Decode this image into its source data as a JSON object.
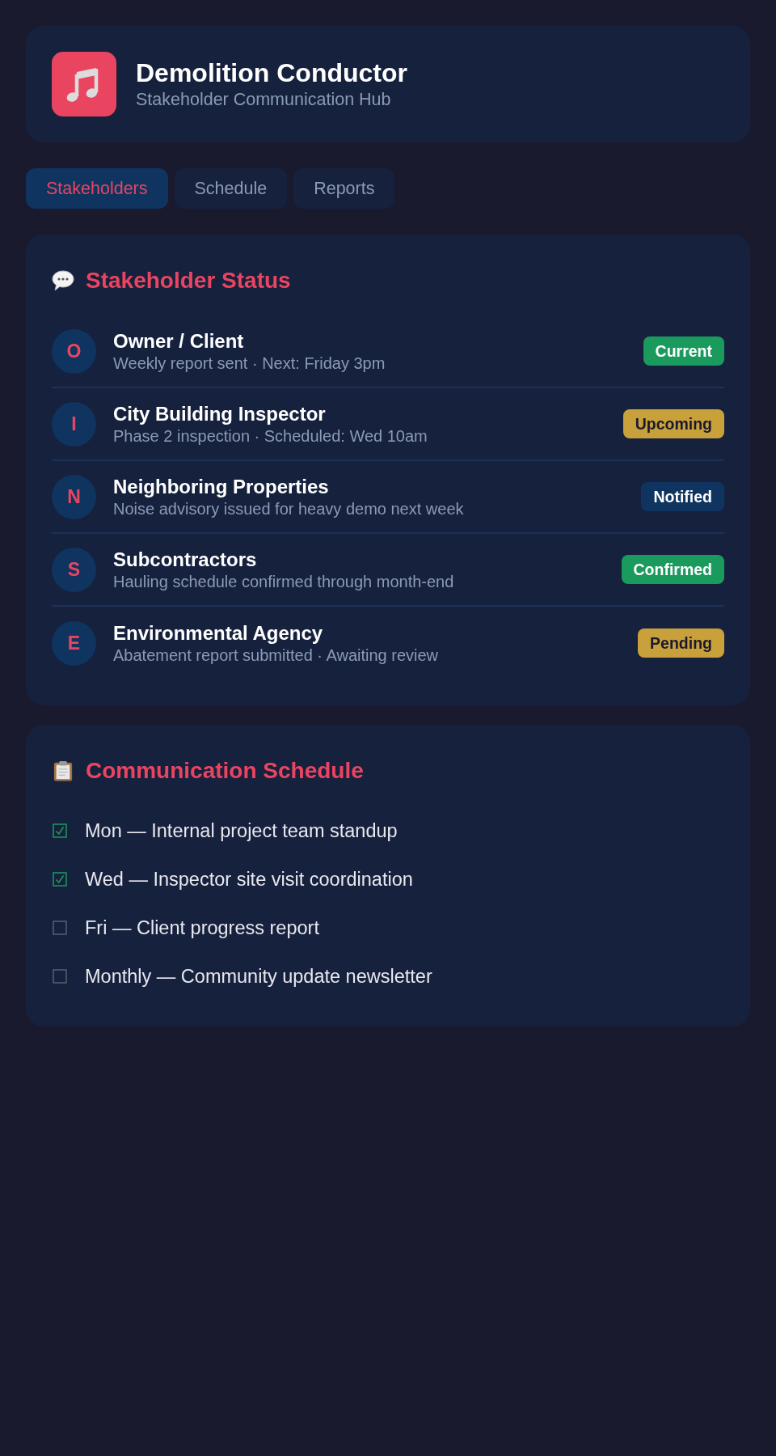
{
  "header": {
    "title": "Demolition Conductor",
    "subtitle": "Stakeholder Communication Hub"
  },
  "tabs": [
    {
      "label": "Stakeholders",
      "selected": true
    },
    {
      "label": "Schedule",
      "selected": false
    },
    {
      "label": "Reports",
      "selected": false
    }
  ],
  "stakeholder_status": {
    "title": "Stakeholder Status",
    "items": [
      {
        "initial": "O",
        "name": "Owner / Client",
        "detail": "Weekly report sent · Next: Friday 3pm",
        "status": "Current",
        "color": "#1b9a5d"
      },
      {
        "initial": "I",
        "name": "City Building Inspector",
        "detail": "Phase 2 inspection · Scheduled: Wed 10am",
        "status": "Upcoming",
        "color": "#c9a13b"
      },
      {
        "initial": "N",
        "name": "Neighboring Properties",
        "detail": "Noise advisory issued for heavy demo next week",
        "status": "Notified",
        "color": "#0f3460"
      },
      {
        "initial": "S",
        "name": "Subcontractors",
        "detail": "Hauling schedule confirmed through month-end",
        "status": "Confirmed",
        "color": "#1b9a5d"
      },
      {
        "initial": "E",
        "name": "Environmental Agency",
        "detail": "Abatement report submitted · Awaiting review",
        "status": "Pending",
        "color": "#c9a13b"
      }
    ]
  },
  "communication_schedule": {
    "title": "Communication Schedule",
    "items": [
      {
        "text": "Mon — Internal project team standup",
        "checked": true
      },
      {
        "text": "Wed — Inspector site visit coordination",
        "checked": true
      },
      {
        "text": "Fri — Client progress report",
        "checked": false
      },
      {
        "text": "Monthly — Community update newsletter",
        "checked": false
      }
    ]
  }
}
